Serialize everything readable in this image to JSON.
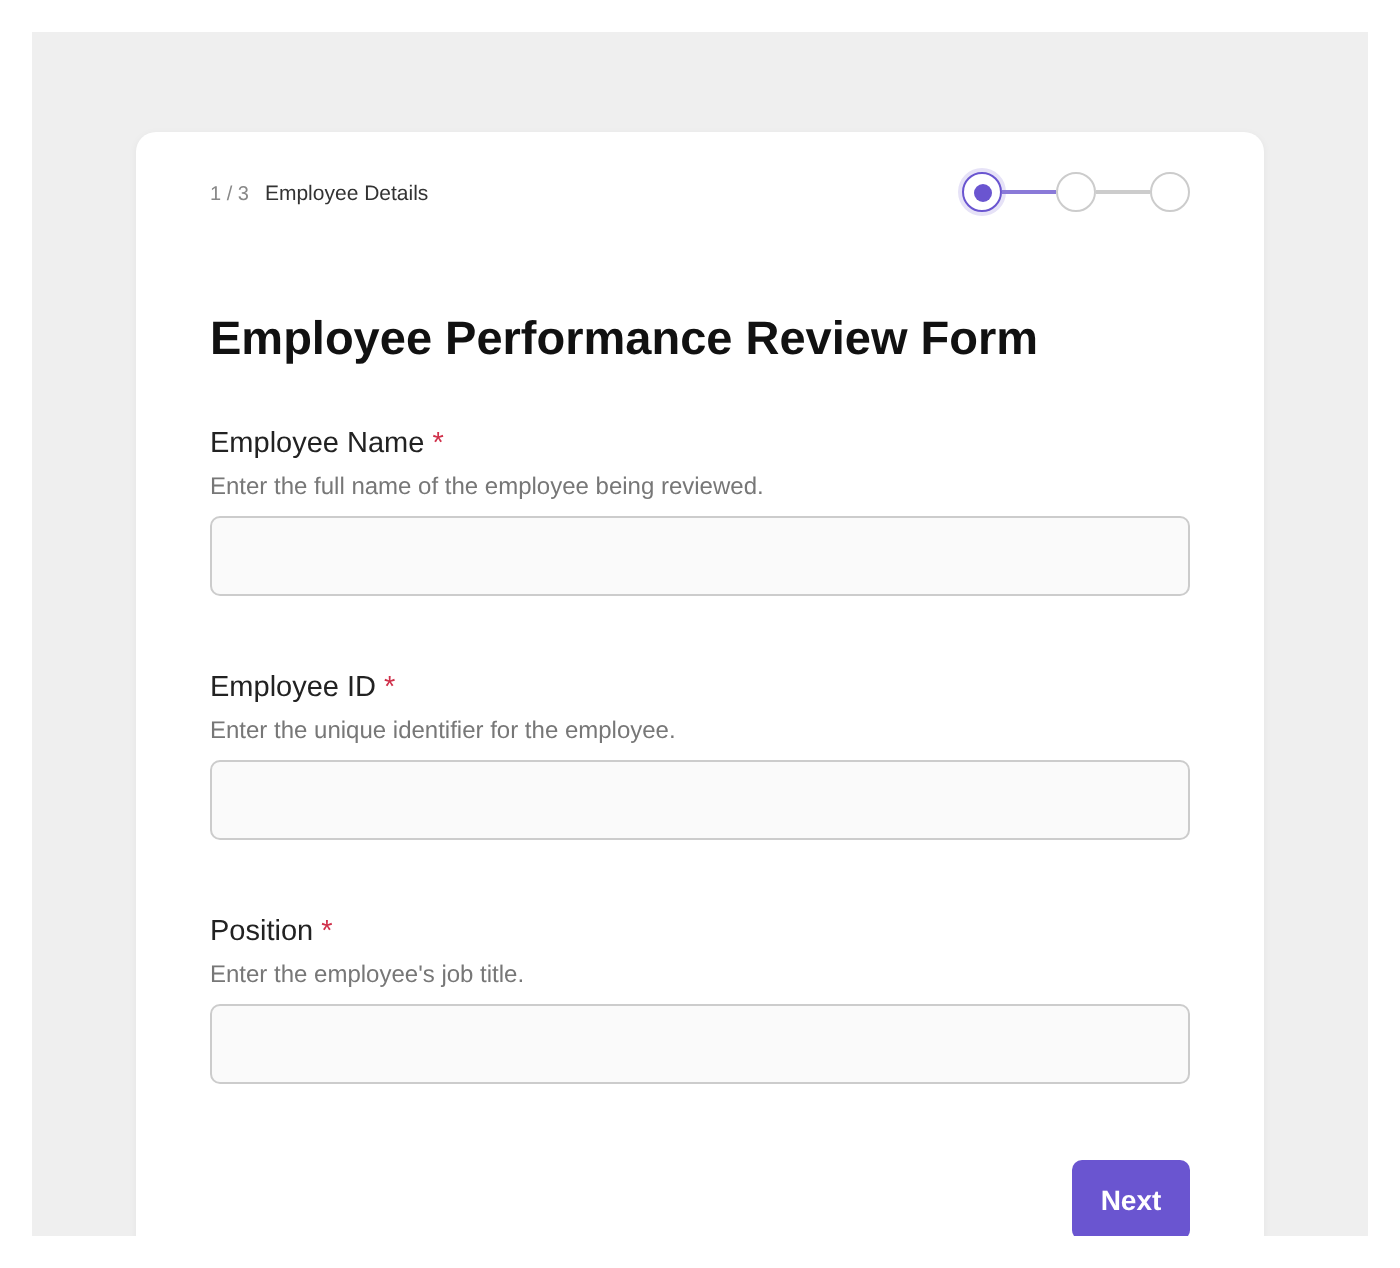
{
  "progress": {
    "counter": "1 / 3",
    "step_title": "Employee Details"
  },
  "steps": [
    {
      "selected": true
    },
    {
      "selected": false
    },
    {
      "selected": false
    }
  ],
  "title": "Employee Performance Review Form",
  "fields": [
    {
      "label": "Employee Name",
      "required_mark": "*",
      "help": "Enter the full name of the employee being reviewed."
    },
    {
      "label": "Employee ID",
      "required_mark": "*",
      "help": "Enter the unique identifier for the employee."
    },
    {
      "label": "Position",
      "required_mark": "*",
      "help": "Enter the employee's job title."
    }
  ],
  "next_button": "Next"
}
